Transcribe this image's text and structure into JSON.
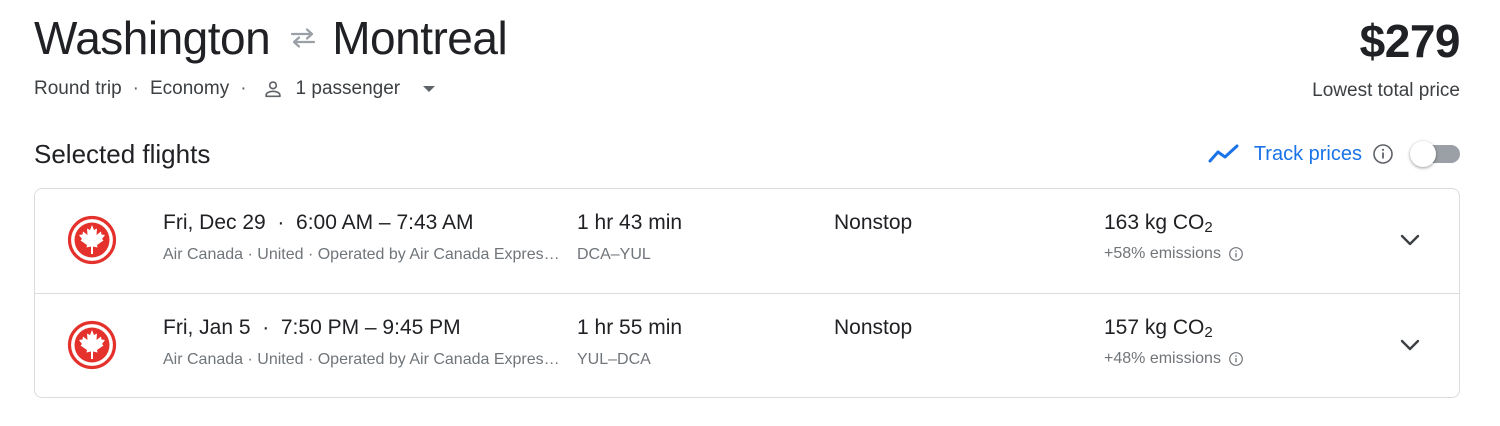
{
  "trip": {
    "origin": "Washington",
    "destination": "Montreal",
    "swap_icon": "swap-arrows-icon",
    "trip_type": "Round trip",
    "cabin": "Economy",
    "passengers": "1 passenger",
    "separator": "·"
  },
  "price": {
    "amount": "$279",
    "label": "Lowest total price"
  },
  "selected": {
    "title": "Selected flights",
    "track_label": "Track prices",
    "track_enabled": false
  },
  "flights": [
    {
      "date": "Fri, Dec 29",
      "times": "6:00 AM – 7:43 AM",
      "airlines": "Air Canada · United · Operated by Air Canada Express - Jazz",
      "duration": "1 hr 43 min",
      "airports": "DCA–YUL",
      "stops": "Nonstop",
      "co2_value": "163 kg CO",
      "co2_sub": "2",
      "emissions": "+58% emissions"
    },
    {
      "date": "Fri, Jan 5",
      "times": "7:50 PM – 9:45 PM",
      "airlines": "Air Canada · United · Operated by Air Canada Express - Jazz",
      "duration": "1 hr 55 min",
      "airports": "YUL–DCA",
      "stops": "Nonstop",
      "co2_value": "157 kg CO",
      "co2_sub": "2",
      "emissions": "+48% emissions"
    }
  ],
  "colors": {
    "accent": "#1a73e8",
    "air_canada_red": "#e4312b",
    "muted_text": "#70757a",
    "border": "#dadce0"
  }
}
